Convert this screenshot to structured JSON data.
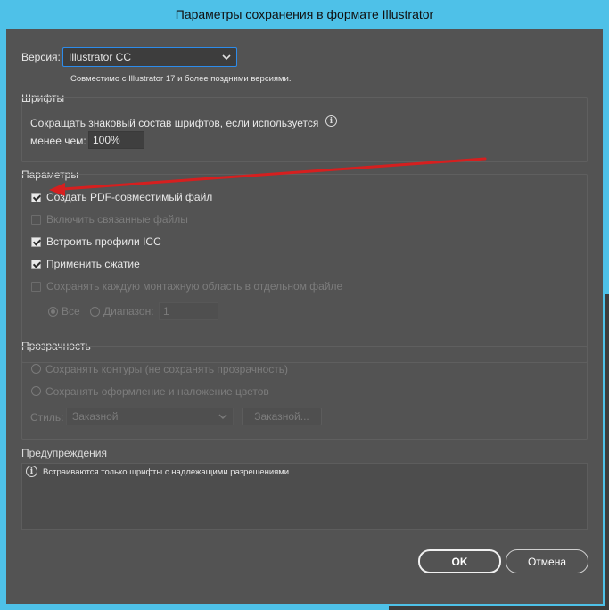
{
  "window": {
    "title": "Параметры сохранения в формате Illustrator"
  },
  "version": {
    "label": "Версия:",
    "value": "Illustrator CC",
    "compat_note": "Совместимо с Illustrator 17 и более поздними версиями."
  },
  "fonts": {
    "title": "Шрифты",
    "subset_label_line1": "Сокращать знаковый состав шрифтов, если используется",
    "subset_label_line2": "менее чем:",
    "subset_value": "100%"
  },
  "options": {
    "title": "Параметры",
    "create_pdf": {
      "label": "Создать PDF-совместимый файл",
      "checked": true
    },
    "include_linked": {
      "label": "Включить связанные файлы",
      "checked": false,
      "enabled": false
    },
    "embed_icc": {
      "label": "Встроить профили ICC",
      "checked": true
    },
    "use_compression": {
      "label": "Применить сжатие",
      "checked": true
    },
    "save_artboards": {
      "label": "Сохранять каждую монтажную область в отдельном файле",
      "checked": false,
      "enabled": false
    },
    "all_label": "Все",
    "range_label": "Диапазон:",
    "range_value": "1"
  },
  "transparency": {
    "title": "Прозрачность",
    "preserve_paths": "Сохранять контуры (не сохранять прозрачность)",
    "preserve_appearance": "Сохранять оформление и наложение цветов",
    "style_label": "Стиль:",
    "style_value": "Заказной",
    "custom_button": "Заказной..."
  },
  "warnings": {
    "title": "Предупреждения",
    "message": "Встраиваются только шрифты с надлежащими разрешениями."
  },
  "buttons": {
    "ok": "OK",
    "cancel": "Отмена"
  },
  "colors": {
    "title_bar": "#4ec1e8",
    "dialog_bg": "#535353",
    "focus_border": "#2d8ceb",
    "annotation_arrow": "#d61f1f"
  }
}
